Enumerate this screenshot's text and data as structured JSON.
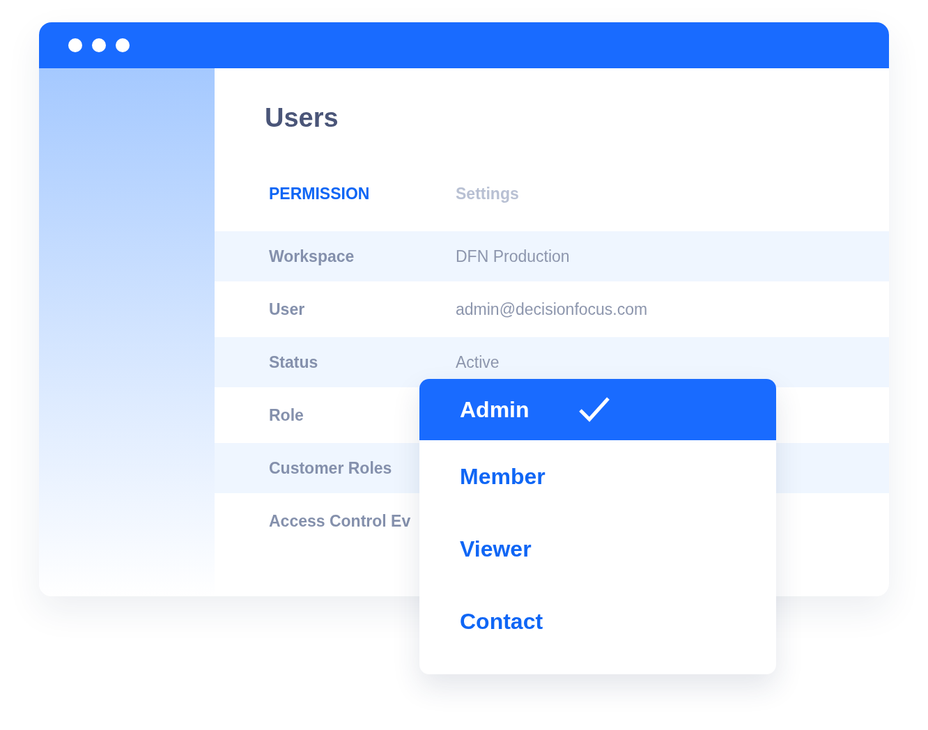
{
  "window": {
    "title": "Users"
  },
  "tabs": [
    {
      "label": "PERMISSION",
      "selected": true
    },
    {
      "label": "Settings",
      "selected": false
    }
  ],
  "rows": [
    {
      "label": "Workspace",
      "value": "DFN Production"
    },
    {
      "label": "User",
      "value": "admin@decisionfocus.com"
    },
    {
      "label": "Status",
      "value": "Active"
    },
    {
      "label": "Role"
    },
    {
      "label": "Customer Roles"
    },
    {
      "label": "Access Control Ev"
    }
  ],
  "role_dropdown": {
    "options": [
      {
        "label": "Admin",
        "selected": true
      },
      {
        "label": "Member",
        "selected": false
      },
      {
        "label": "Viewer",
        "selected": false
      },
      {
        "label": "Contact",
        "selected": false
      }
    ]
  }
}
